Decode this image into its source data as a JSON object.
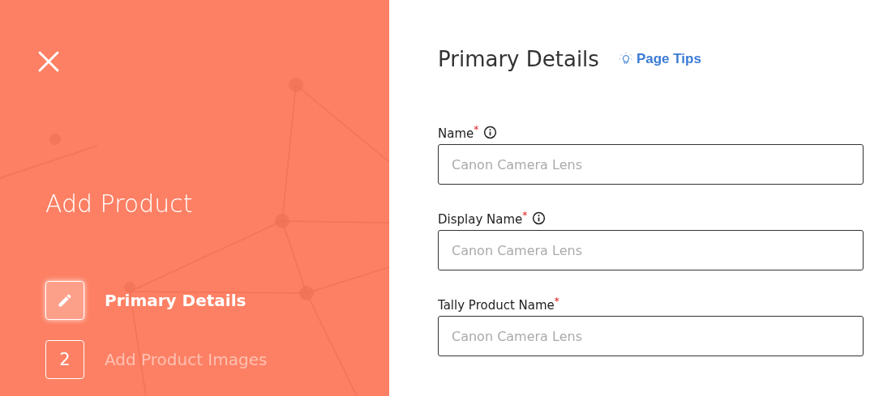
{
  "sidebar": {
    "title": "Add Product",
    "steps": [
      {
        "kind": "edit",
        "label": "Primary Details",
        "selected": true
      },
      {
        "kind": "number",
        "number": "2",
        "label": "Add Product Images",
        "selected": false
      }
    ]
  },
  "form": {
    "heading": "Primary Details",
    "tips_link": "Page Tips",
    "fields": [
      {
        "label": "Name",
        "required_mark": "*",
        "info": true,
        "placeholder": "Canon Camera Lens"
      },
      {
        "label": "Display Name",
        "required_mark": "*",
        "info": true,
        "placeholder": "Canon Camera Lens"
      },
      {
        "label": "Tally Product Name",
        "required_mark": "*",
        "info": false,
        "placeholder": "Canon Camera Lens"
      }
    ]
  }
}
